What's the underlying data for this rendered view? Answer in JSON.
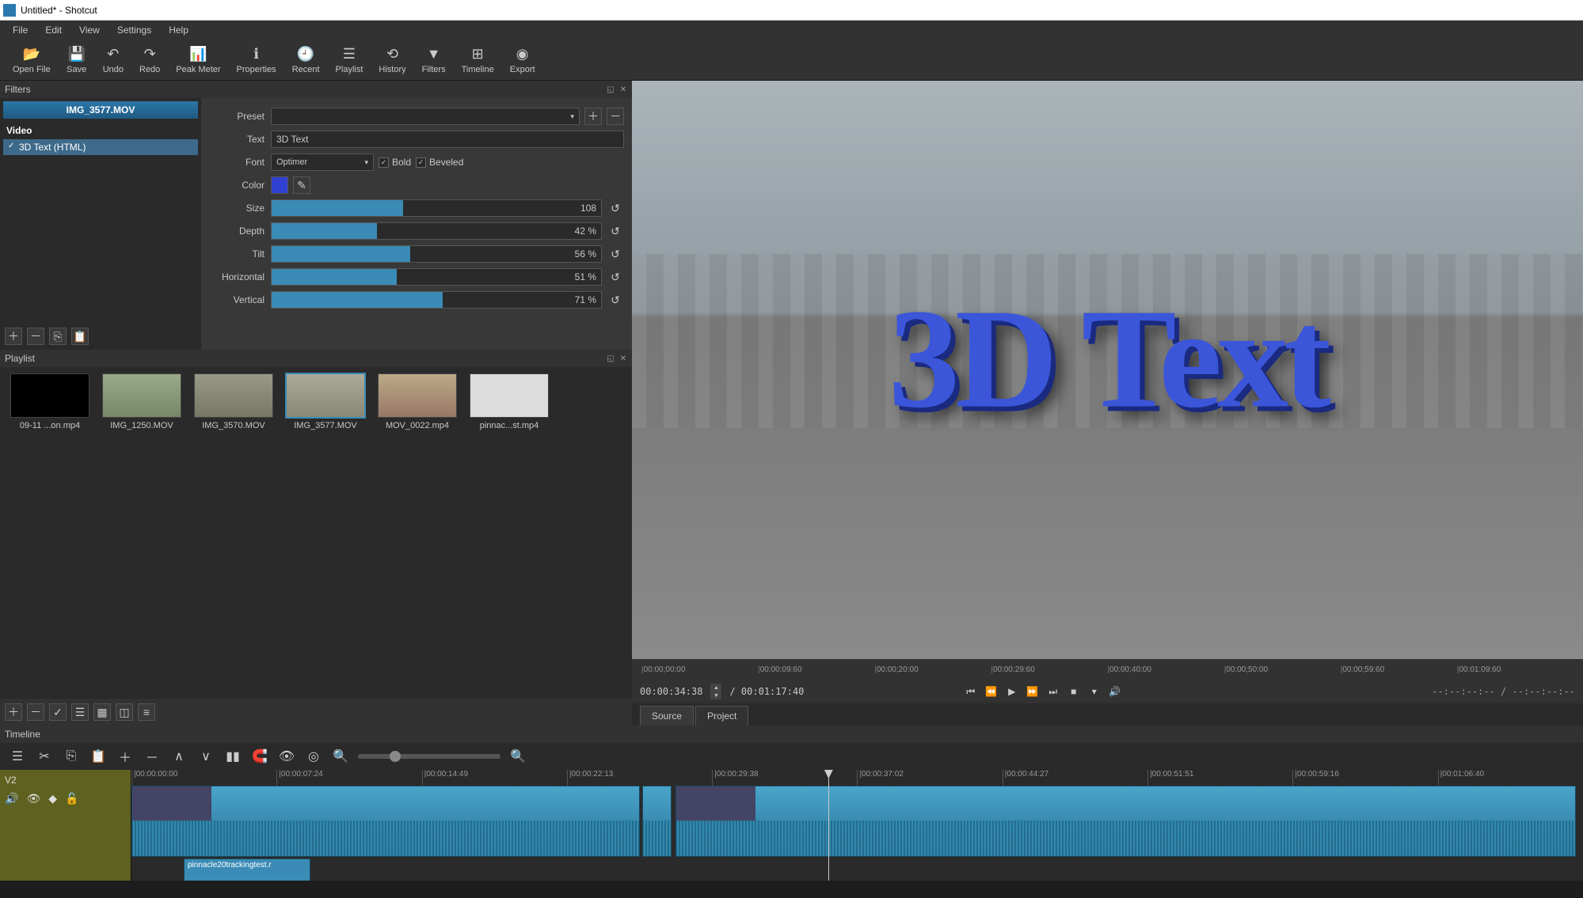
{
  "title": "Untitled* - Shotcut",
  "menu": [
    "File",
    "Edit",
    "View",
    "Settings",
    "Help"
  ],
  "toolbar": [
    {
      "icon": "📂",
      "label": "Open File"
    },
    {
      "icon": "💾",
      "label": "Save"
    },
    {
      "icon": "↶",
      "label": "Undo"
    },
    {
      "icon": "↷",
      "label": "Redo"
    },
    {
      "icon": "📊",
      "label": "Peak Meter"
    },
    {
      "icon": "ℹ",
      "label": "Properties"
    },
    {
      "icon": "🕘",
      "label": "Recent"
    },
    {
      "icon": "☰",
      "label": "Playlist"
    },
    {
      "icon": "⟲",
      "label": "History"
    },
    {
      "icon": "▼",
      "label": "Filters"
    },
    {
      "icon": "⊞",
      "label": "Timeline"
    },
    {
      "icon": "◉",
      "label": "Export"
    }
  ],
  "filters": {
    "panel": "Filters",
    "clip": "IMG_3577.MOV",
    "category": "Video",
    "applied": "3D Text (HTML)",
    "preset_label": "Preset",
    "text_label": "Text",
    "text_value": "3D Text",
    "font_label": "Font",
    "font_value": "Optimer",
    "bold": "Bold",
    "beveled": "Beveled",
    "color_label": "Color",
    "sliders": [
      {
        "label": "Size",
        "value": "108",
        "pct": 40
      },
      {
        "label": "Depth",
        "value": "42 %",
        "pct": 32
      },
      {
        "label": "Tilt",
        "value": "56 %",
        "pct": 42
      },
      {
        "label": "Horizontal",
        "value": "51 %",
        "pct": 38
      },
      {
        "label": "Vertical",
        "value": "71 %",
        "pct": 52
      }
    ]
  },
  "playlist": {
    "panel": "Playlist",
    "items": [
      {
        "name": "09-11 ...on.mp4"
      },
      {
        "name": "IMG_1250.MOV"
      },
      {
        "name": "IMG_3570.MOV"
      },
      {
        "name": "IMG_3577.MOV",
        "selected": true
      },
      {
        "name": "MOV_0022.mp4"
      },
      {
        "name": "pinnac...st.mp4"
      }
    ]
  },
  "preview": {
    "text3d": "3D Text",
    "ruler": [
      "|00:00;00:00",
      "|00:00:09:60",
      "|00:00;20:00",
      "|00:00:29:60",
      "|00:00;40:00",
      "|00:00;50:00",
      "|00:00;59:60",
      "|00:01:09:60"
    ],
    "tc_current": "00:00:34:38",
    "tc_total": "/ 00:01:17:40",
    "inout": "--:--:--:-- /        --:--:--:--",
    "tabs": {
      "source": "Source",
      "project": "Project"
    }
  },
  "timeline": {
    "panel": "Timeline",
    "track": "V2",
    "ruler": [
      "|00:00:00:00",
      "|00:00:07:24",
      "|00:00:14:49",
      "|00:00:22:13",
      "|00:00:29:38",
      "|00:00:37:02",
      "|00:00:44:27",
      "|00:00:51:51",
      "|00:00:59:16",
      "|00:01:06:40"
    ],
    "clip2": "pinnacle20trackingtest.r"
  }
}
